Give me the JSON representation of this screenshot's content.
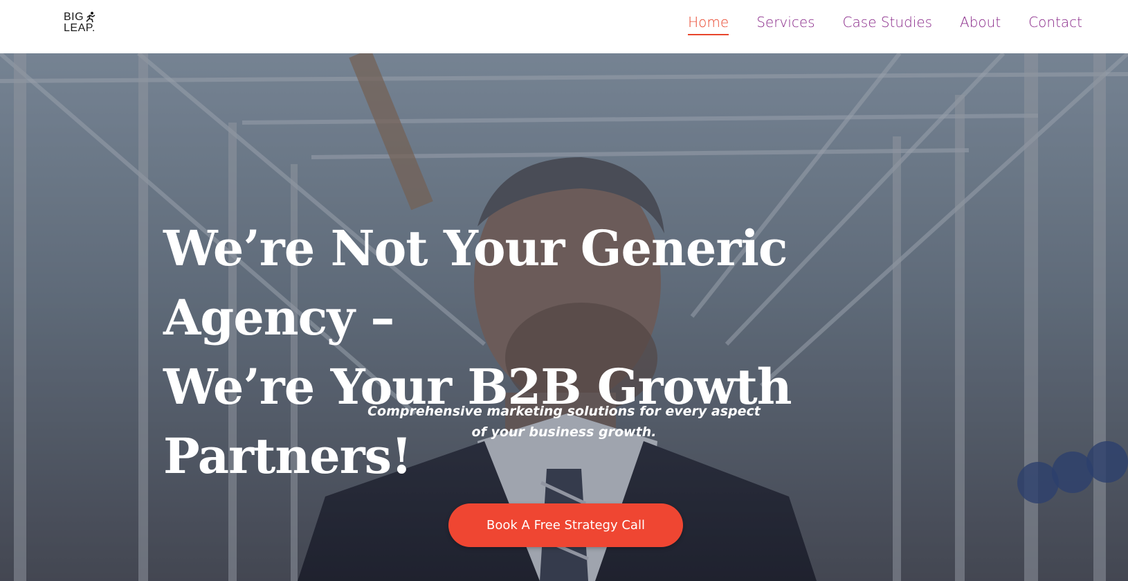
{
  "header": {
    "logo": {
      "line1": "BIG",
      "line2": "LEAP."
    },
    "nav": [
      {
        "label": "Home",
        "active": true
      },
      {
        "label": "Services",
        "active": false
      },
      {
        "label": "Case Studies",
        "active": false
      },
      {
        "label": "About",
        "active": false
      },
      {
        "label": "Contact",
        "active": false
      }
    ]
  },
  "hero": {
    "title_line1": "We’re Not Your Generic Agency –",
    "title_line2": "We’re Your B2B Growth Partners!",
    "subtitle_line1": "Comprehensive marketing solutions for every aspect",
    "subtitle_line2": "of your business growth.",
    "cta_label": "Book A Free Strategy Call"
  },
  "colors": {
    "accent": "#ef4632",
    "nav_text": "#8a2a8a",
    "nav_active": "#e8452c",
    "header_bg": "#ffffff"
  }
}
